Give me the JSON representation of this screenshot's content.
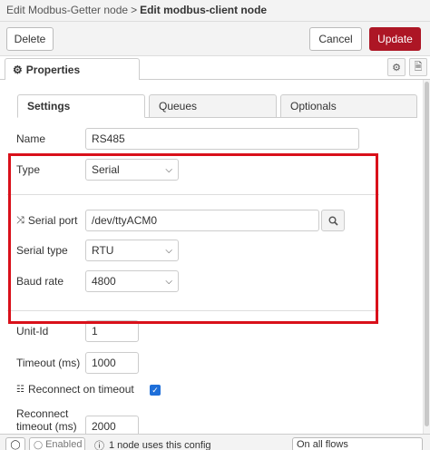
{
  "breadcrumb": {
    "previous": "Edit Modbus-Getter node",
    "separator": ">",
    "current": "Edit modbus-client node"
  },
  "actions": {
    "delete": "Delete",
    "cancel": "Cancel",
    "update": "Update",
    "update_color": "#ad1625"
  },
  "tabs": {
    "properties": "Properties",
    "properties_icon": "gear-icon"
  },
  "subtabs": [
    "Settings",
    "Queues",
    "Optionals"
  ],
  "form": {
    "name": {
      "label": "Name",
      "value": "RS485"
    },
    "type": {
      "label": "Type",
      "value": "Serial"
    },
    "serial_port": {
      "label": "Serial port",
      "value": "/dev/ttyACM0",
      "icon": "shuffle-icon"
    },
    "serial_type": {
      "label": "Serial type",
      "value": "RTU"
    },
    "baud_rate": {
      "label": "Baud rate",
      "value": "4800"
    },
    "unit_id": {
      "label": "Unit-Id",
      "value": "1"
    },
    "timeout": {
      "label": "Timeout (ms)",
      "value": "1000"
    },
    "reconnect_on_timeout": {
      "label": "Reconnect on timeout",
      "checked": true,
      "icon": "grid-icon"
    },
    "reconnect_timeout": {
      "label_line1": "Reconnect",
      "label_line2": "timeout (ms)",
      "value": "2000"
    }
  },
  "highlight_color": "#d9101a",
  "footer": {
    "enabled": "Enabled",
    "info": "1 node uses this config",
    "scope": "On all flows"
  }
}
